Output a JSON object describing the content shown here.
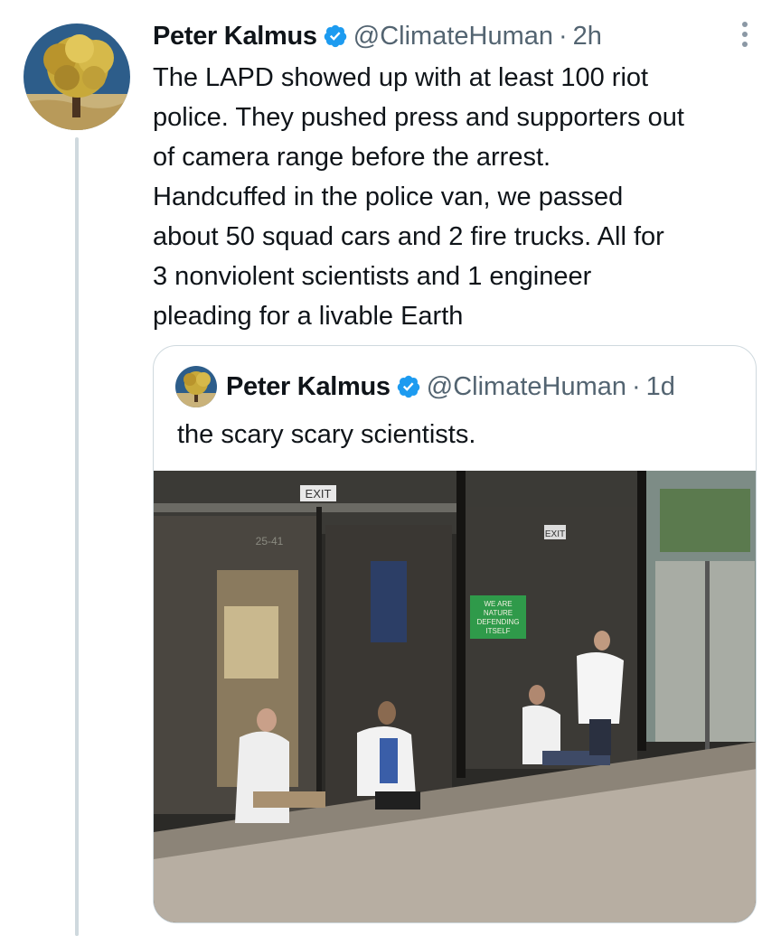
{
  "tweet": {
    "author_name": "Peter Kalmus",
    "handle": "@ClimateHuman",
    "separator": "·",
    "time": "2h",
    "text": "The LAPD showed up with at least 100 riot\npolice. They pushed press and supporters out\nof camera range before the arrest.\nHandcuffed in the police van, we passed\nabout 50 squad cars and 2 fire trucks. All for\n3 nonviolent scientists and 1 engineer\npleading for a livable Earth"
  },
  "quoted_tweet": {
    "author_name": "Peter Kalmus",
    "handle": "@ClimateHuman",
    "separator": "·",
    "time": "1d",
    "text": "the scary scary scientists."
  },
  "photo": {
    "exit_sign_left": "EXIT",
    "exit_sign_right": "EXIT",
    "building_number": "25-41",
    "protest_sign": [
      "WE ARE",
      "NATURE",
      "DEFENDING",
      "ITSELF"
    ]
  },
  "icons": {
    "verified": "verified-badge-icon",
    "more": "more-options-icon"
  },
  "colors": {
    "text": "#0f1419",
    "secondary": "#536471",
    "verified": "#1d9bf0",
    "border": "#cfd9de",
    "thread_line": "#cfd9de"
  }
}
